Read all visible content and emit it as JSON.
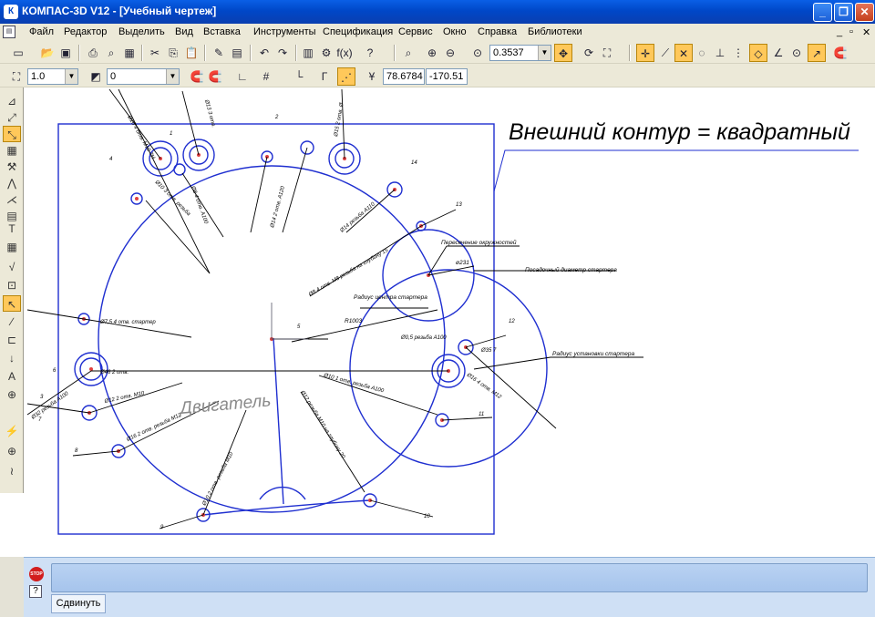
{
  "window": {
    "title": "КОМПАС-3D V12 - [Учебный чертеж]",
    "buttons": [
      "_",
      "❐",
      "✕"
    ]
  },
  "menu": {
    "items": [
      "Файл",
      "Редактор",
      "Выделить",
      "Вид",
      "Вставка",
      "Инструменты",
      "Спецификация",
      "Сервис",
      "Окно",
      "Справка",
      "Библиотеки"
    ],
    "mdi_controls": [
      "_",
      "▫",
      "✕"
    ]
  },
  "toolbar_standard": {
    "zoom_value": "0.3537"
  },
  "toolbar_current_state": {
    "scale_value": "1.0",
    "layer_value": "0",
    "coord_x": "78.6784",
    "coord_y": "-170.51"
  },
  "drawing": {
    "heading": "Внешний контур = квадратный",
    "engine_label": "Двигатель",
    "labels": {
      "intersection": "Пересечение окружностей",
      "base_diameter": "Посадочный диаметр стартера",
      "starter_center_radius": "Радиус центра стартера",
      "starter_mount_radius": "Радиус установки стартера",
      "d231": "ø231",
      "r1003": "R1003"
    },
    "hole_numbers": [
      "1",
      "2",
      "3",
      "4",
      "5",
      "6",
      "7",
      "8",
      "9",
      "10",
      "11",
      "12",
      "13",
      "14"
    ]
  },
  "status": {
    "command_tab": "Сдвинуть"
  },
  "colors": {
    "drawing_blue": "#1f2fd0",
    "center_red": "#e04040",
    "title_gradient": "#0047c8",
    "active_button": "#ffc85a"
  }
}
